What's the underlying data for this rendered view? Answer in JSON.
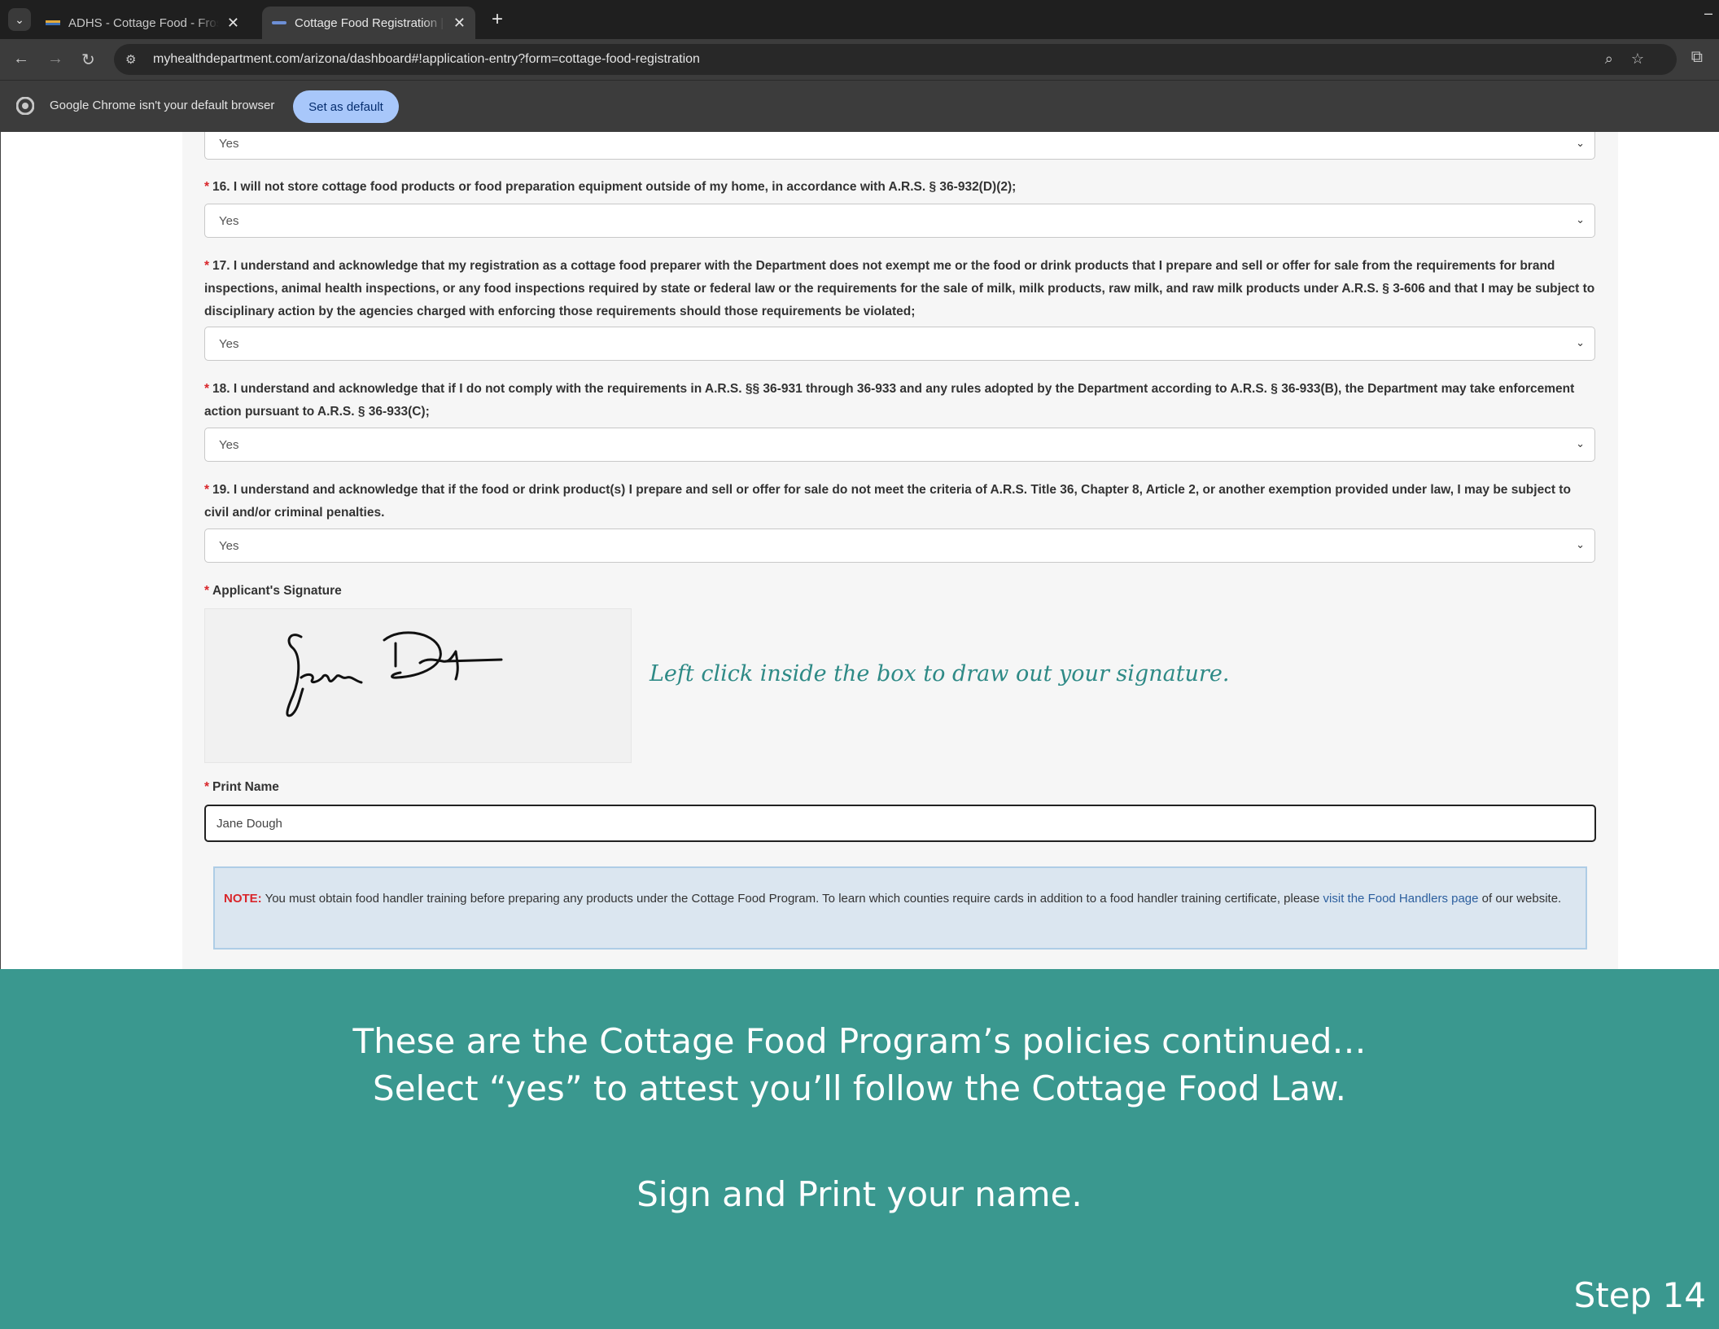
{
  "browser": {
    "tabs": [
      {
        "title": "ADHS - Cottage Food - Frosting",
        "active": false
      },
      {
        "title": "Cottage Food Registration | Arizona",
        "active": true
      }
    ],
    "url": "myhealthdepartment.com/arizona/dashboard#!application-entry?form=cottage-food-registration",
    "infobar_text": "Google Chrome isn't your default browser",
    "set_default_label": "Set as default"
  },
  "form": {
    "q15_value": "Yes",
    "questions": [
      {
        "number": "16.",
        "text": "I will not store cottage food products or food preparation equipment outside of my home, in accordance with A.R.S. § 36-932(D)(2);",
        "value": "Yes"
      },
      {
        "number": "17.",
        "text": "I understand and acknowledge that my registration as a cottage food preparer with the Department does not exempt me or the food or drink products that I prepare and sell or offer for sale from the requirements for brand inspections, animal health inspections, or any food inspections required by state or federal law or the requirements for the sale of milk, milk products, raw milk, and raw milk products under A.R.S. § 3-606 and that I may be subject to disciplinary action by the agencies charged with enforcing those requirements should those requirements be violated;",
        "value": "Yes"
      },
      {
        "number": "18.",
        "text": "I understand and acknowledge that if I do not comply with the requirements in A.R.S. §§ 36-931 through 36-933 and any rules adopted by the Department according to A.R.S. § 36-933(B), the Department may take enforcement action pursuant to A.R.S. § 36-933(C);",
        "value": "Yes"
      },
      {
        "number": "19.",
        "text": "I understand and acknowledge that if the food or drink product(s) I prepare and sell or offer for sale do not meet the criteria of A.R.S. Title 36, Chapter 8, Article 2, or another exemption provided under law, I may be subject to civil and/or criminal penalties.",
        "value": "Yes"
      }
    ],
    "signature_label": "Applicant's Signature",
    "signature_hint": "Left click inside the box to draw out your signature.",
    "print_name_label": "Print Name",
    "print_name_value": "Jane Dough",
    "note": {
      "label": "NOTE:",
      "text": " You must obtain food handler training before preparing any products under the Cottage Food Program. To learn which counties require cards in addition to a food handler training certificate, please ",
      "link": "visit the Food Handlers page",
      "tail": " of our website."
    }
  },
  "caption": {
    "line1": "These are the Cottage Food Program’s policies continued…",
    "line2": "Select “yes” to attest you’ll follow the Cottage Food Law.",
    "line3": "Sign and Print your name.",
    "step": "Step 14"
  },
  "colors": {
    "caption_bg": "#3a988f",
    "required_asterisk": "#d9262b",
    "signature_hint": "#2e8a86",
    "default_button": "#a8c7fa"
  }
}
